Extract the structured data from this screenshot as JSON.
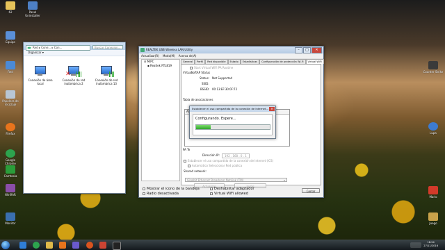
{
  "desktop": {
    "icons_left": [
      {
        "label": "62",
        "icon": "user-folder-icon",
        "color": "#e6c35a"
      },
      {
        "label": "Panel Uninstaller",
        "icon": "uninstaller-icon",
        "color": "#4d7fc4"
      },
      {
        "label": "Equipo",
        "icon": "computer-icon",
        "color": "#5a8fd8"
      },
      {
        "label": "Red",
        "icon": "network-icon",
        "color": "#4b8ad6"
      },
      {
        "label": "Papelera de reciclaje",
        "icon": "recycle-bin-icon",
        "color": "#b8c6d4"
      },
      {
        "label": "Firefox",
        "icon": "firefox-icon",
        "color": "#e8741c"
      },
      {
        "label": "Google Chrome",
        "icon": "chrome-icon",
        "color": "#2da44e"
      },
      {
        "label": "Camtasia",
        "icon": "camtasia-icon",
        "color": "#2a9d3a"
      },
      {
        "label": "WinRAR",
        "icon": "winrar-icon",
        "color": "#8a4ea8"
      },
      {
        "label": "Monitor",
        "icon": "monitor-icon",
        "color": "#3a6fb0"
      }
    ],
    "icons_right": [
      {
        "label": "Counter Strike",
        "icon": "cs-icon",
        "color": "#3a3a3a"
      },
      {
        "label": "Lupa",
        "icon": "magnifier-icon",
        "color": "#3d7bd1"
      },
      {
        "label": "Mario",
        "icon": "mario-icon",
        "color": "#d33a2a"
      },
      {
        "label": "Juego",
        "icon": "game-icon",
        "color": "#c8a24a"
      }
    ]
  },
  "explorer": {
    "address": [
      "Red",
      "Cone...",
      "Con..."
    ],
    "search_placeholder": "Buscar Conexion...",
    "toolbar_label": "Organizar ▾",
    "items": [
      {
        "label": "Conexión de área local",
        "disconnected": false
      },
      {
        "label": "Conexión de red inalámbrica 2",
        "disconnected": true
      },
      {
        "label": "Conexión de red inalámbrica 13",
        "disconnected": false
      }
    ]
  },
  "realtek": {
    "title": "REALTEK USB Wireless LAN Utility",
    "menu": [
      "Actualizar(R)",
      "Modo(M)",
      "Acerca de(A)"
    ],
    "tree": [
      "MiPC",
      "Realtek RTL819"
    ],
    "tabs": [
      "General",
      "Perfil",
      "Red disponible",
      "Estado",
      "Estadísticas",
      "Configuración de protección Wi-Fi",
      "Virtual WiFi"
    ],
    "active_tab": "Virtual WiFi",
    "virtual_wifi": {
      "start_label": "Start Virtual WiFi PA Routine",
      "softap_group_label": "Virtual",
      "softap_status_label": "SoftAP Status",
      "status_label": "Status:",
      "status_value": "Not Supported",
      "ssid_label": "SSID:",
      "bssid_label": "BSSID:",
      "bssid_value": "00:13:EF:30:0F:72",
      "table_title": "Tabla de asociaciones",
      "table_headers": [
        "AID",
        "Dirección MAC",
        "Tiempo d..."
      ],
      "pa_label": "PA Te",
      "ip_label": "Dirección IP:",
      "ip_value": "192 . 168 . 0 . 1",
      "share_label": "Establecer el uso compartido de la conexión de Internet (ICS)",
      "auto_label": "Automático Seleccionar Red pública",
      "shared_network_label": "Shared network:",
      "shared_network_value": "Gigabit Ethernet Broadcom NetLink (TM)",
      "update_button": "Actualizar",
      "install_button": "Instal"
    },
    "footer": {
      "show_tray": "Mostrar el icono de la bandeja",
      "radio_off": "Radio desactivada",
      "disable_adapter": "Deshabilitar adaptador",
      "virtual_wifi_allowed": "Virtual WiFi allowed",
      "close_button": "Cerrar"
    }
  },
  "dialog": {
    "title": "Establecer el uso compartido de la conexión de Internet...",
    "message": "Configurando. Espere...",
    "progress": 0.2
  },
  "taskbar": {
    "time": "18:24",
    "date": "27/11/2016",
    "apps": [
      {
        "icon": "ie-icon",
        "color": "#2f7ed8"
      },
      {
        "icon": "chrome-icon",
        "color": "#2da44e"
      },
      {
        "icon": "explorer-icon",
        "color": "#e0b94a"
      },
      {
        "icon": "media-player-icon",
        "color": "#e8741c"
      },
      {
        "icon": "firefox-icon",
        "color": "#d9531e"
      },
      {
        "icon": "realtek-icon",
        "color": "#6a5acd"
      },
      {
        "icon": "paint-icon",
        "color": "#c43"
      },
      {
        "icon": "cmd-icon",
        "color": "#222"
      }
    ]
  }
}
